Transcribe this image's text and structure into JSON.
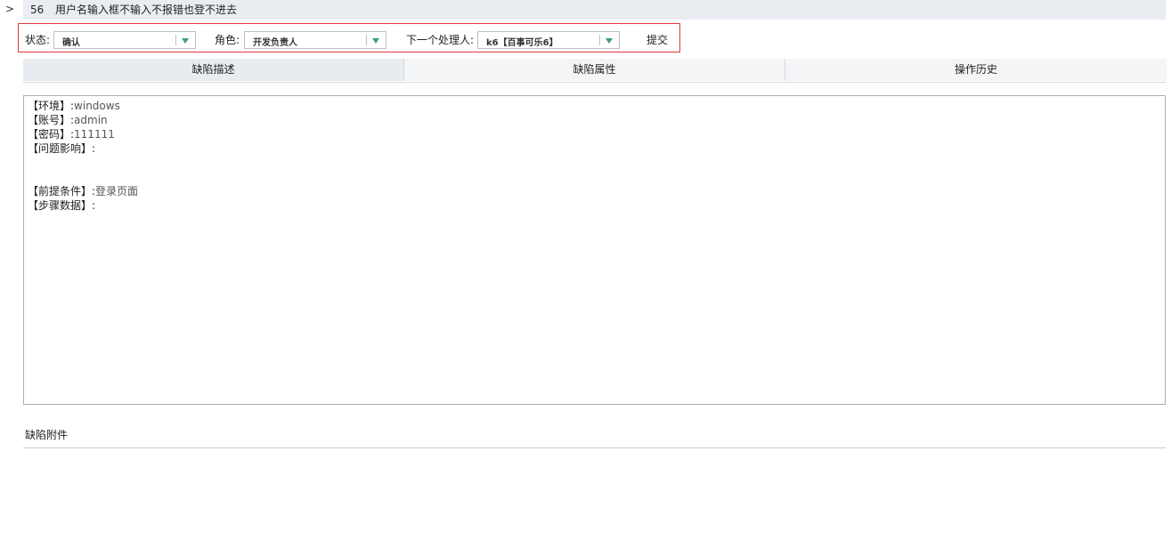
{
  "header": {
    "caret": ">",
    "issue_id": "56",
    "issue_title": "用户名输入框不输入不报错也登不进去"
  },
  "toolbar": {
    "status_label": "状态:",
    "status_value": "确认",
    "role_label": "角色:",
    "role_value": "开发负责人",
    "next_handler_label": "下一个处理人:",
    "next_handler_value": "k6【百事可乐6】",
    "submit_label": "提交",
    "accent_color": "#e0373d",
    "arrow_color": "#3a9c8c"
  },
  "tabs": [
    {
      "label": "缺陷描述"
    },
    {
      "label": "缺陷属性"
    },
    {
      "label": "操作历史"
    }
  ],
  "description": {
    "lines": [
      {
        "key": "【环境】:",
        "value": "windows"
      },
      {
        "key": "【账号】:",
        "value": "admin"
      },
      {
        "key": "【密码】:",
        "value": "111111"
      },
      {
        "key": "【问题影响】:",
        "value": ""
      },
      {
        "key": "",
        "value": ""
      },
      {
        "key": "",
        "value": ""
      },
      {
        "key": "【前提条件】:",
        "value": "登录页面"
      },
      {
        "key": "【步骤数据】:",
        "value": ""
      }
    ]
  },
  "attachments": {
    "title": "缺陷附件"
  }
}
